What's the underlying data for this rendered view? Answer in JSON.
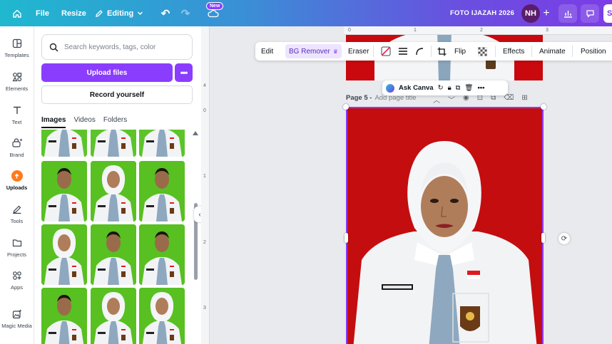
{
  "topbar": {
    "file": "File",
    "resize": "Resize",
    "editing": "Editing",
    "new_badge": "New",
    "doc_title": "FOTO IJAZAH 2026",
    "avatar": "NH",
    "plus": "+",
    "share_initial": "S"
  },
  "rail": {
    "items": [
      {
        "label": "Templates",
        "icon": "templates-icon"
      },
      {
        "label": "Elements",
        "icon": "elements-icon"
      },
      {
        "label": "Text",
        "icon": "text-icon"
      },
      {
        "label": "Brand",
        "icon": "brand-icon"
      },
      {
        "label": "Uploads",
        "icon": "uploads-icon"
      },
      {
        "label": "Tools",
        "icon": "tools-icon"
      },
      {
        "label": "Projects",
        "icon": "projects-icon"
      },
      {
        "label": "Apps",
        "icon": "apps-icon"
      },
      {
        "label": "Magic Media",
        "icon": "magic-media-icon"
      }
    ]
  },
  "panel": {
    "search_placeholder": "Search keywords, tags, color",
    "upload_label": "Upload files",
    "more_label": "•••",
    "record_label": "Record yourself",
    "tabs": [
      "Images",
      "Videos",
      "Folders"
    ],
    "thumbs": [
      {
        "bg": "#5cc42a",
        "hijab": false
      },
      {
        "bg": "#5cc42a",
        "hijab": false
      },
      {
        "bg": "#5cc42a",
        "hijab": false
      },
      {
        "bg": "#58c021",
        "hijab": false
      },
      {
        "bg": "#58c021",
        "hijab": true
      },
      {
        "bg": "#58c021",
        "hijab": false
      },
      {
        "bg": "#58c021",
        "hijab": true
      },
      {
        "bg": "#58c021",
        "hijab": false
      },
      {
        "bg": "#58c021",
        "hijab": false
      },
      {
        "bg": "#58c021",
        "hijab": false
      },
      {
        "bg": "#58c021",
        "hijab": true
      },
      {
        "bg": "#58c021",
        "hijab": true
      }
    ]
  },
  "canvas": {
    "ruler_top": [
      "0",
      "1",
      "2",
      "3"
    ],
    "ruler_left": [
      "4",
      "0",
      "1",
      "2",
      "3"
    ],
    "page_label": "Page 5 -",
    "page_title_placeholder": "Add page title",
    "page_bg": "#c40d0f"
  },
  "ctx_bar": {
    "edit": "Edit",
    "bg_remover": "BG Remover",
    "eraser": "Eraser",
    "flip": "Flip",
    "effects": "Effects",
    "animate": "Animate",
    "position": "Position"
  },
  "mini_bar": {
    "ask_canva": "Ask Canva",
    "more": "•••"
  },
  "colors": {
    "accent": "#8b3dff",
    "photo_red": "#c40d0f",
    "thumb_green": "#58c021"
  }
}
